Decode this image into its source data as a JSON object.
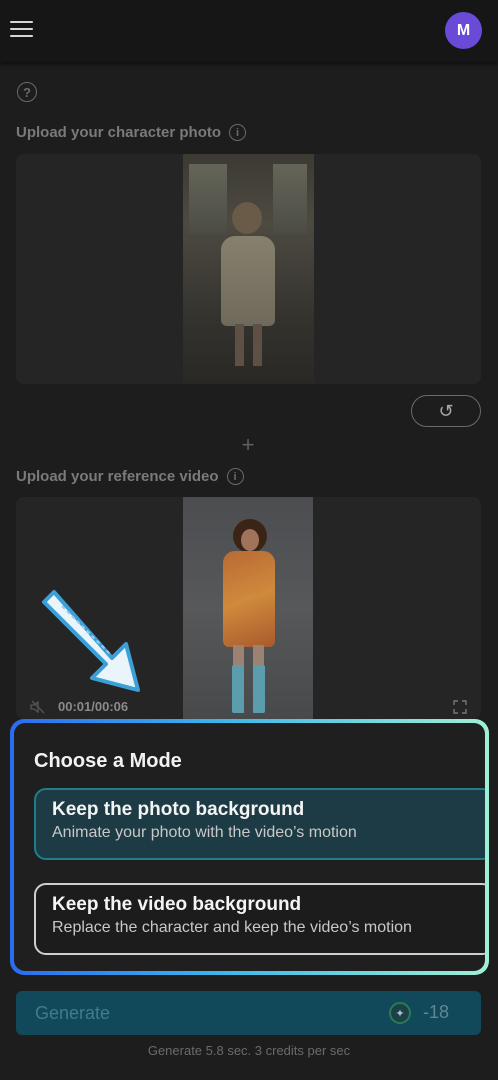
{
  "header": {
    "menu_icon": "hamburger-menu-icon",
    "avatar_initial": "M",
    "avatar_color": "#6a4bd8"
  },
  "help_icon_glyph": "?",
  "character_section": {
    "label": "Upload your character photo",
    "info_glyph": "i",
    "reset_glyph": "↺"
  },
  "plus_glyph": "+",
  "video_section": {
    "label": "Upload your reference video",
    "info_glyph": "i",
    "timecode": "00:01/00:06",
    "mute_icon": "muted-speaker-icon",
    "fullscreen_icon": "fullscreen-icon"
  },
  "mode_panel": {
    "title": "Choose a Mode",
    "options": [
      {
        "title": "Keep the photo background",
        "description": "Animate your photo with the video’s motion",
        "selected": true
      },
      {
        "title": "Keep the video background",
        "description": "Replace the character and keep the video’s motion",
        "selected": false
      }
    ]
  },
  "generate": {
    "label": "Generate",
    "credit_glyph": "✦",
    "credit_count": "-18",
    "accent_color": "#11485a"
  },
  "footnote": "Generate 5.8 sec. 3 credits per sec"
}
